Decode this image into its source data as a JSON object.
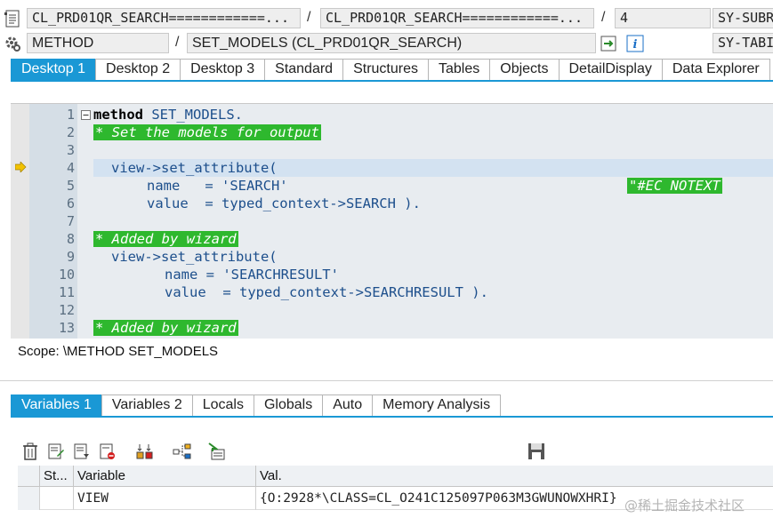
{
  "header": {
    "row1": {
      "field1": "CL_PRD01QR_SEARCH============...",
      "field2": "CL_PRD01QR_SEARCH============...",
      "field3": "4",
      "field4": "SY-SUBRC",
      "sep1": "/",
      "sep2": "/"
    },
    "row2": {
      "field1": "METHOD",
      "sep": "/",
      "field2": "SET_MODELS (CL_PRD01QR_SEARCH)",
      "field3": "SY-TABIX"
    }
  },
  "desktop_tabs": [
    "Desktop 1",
    "Desktop 2",
    "Desktop 3",
    "Standard",
    "Structures",
    "Tables",
    "Objects",
    "DetailDisplay",
    "Data Explorer"
  ],
  "active_desktop_tab": 0,
  "editor": {
    "current_line": 4,
    "lines": [
      {
        "n": "1",
        "text": "method SET_MODELS."
      },
      {
        "n": "2",
        "text": "* Set the models for output"
      },
      {
        "n": "3",
        "text": ""
      },
      {
        "n": "4",
        "text": "view->set_attribute("
      },
      {
        "n": "5",
        "text": "name   = 'SEARCH'",
        "pragma": "\"#EC NOTEXT"
      },
      {
        "n": "6",
        "text": "value  = typed_context->SEARCH )."
      },
      {
        "n": "7",
        "text": ""
      },
      {
        "n": "8",
        "text": "* Added by wizard"
      },
      {
        "n": "9",
        "text": "view->set_attribute("
      },
      {
        "n": "10",
        "text": "name = 'SEARCHRESULT'"
      },
      {
        "n": "11",
        "text": "value  = typed_context->SEARCHRESULT )."
      },
      {
        "n": "12",
        "text": ""
      },
      {
        "n": "13",
        "text": "* Added by wizard"
      }
    ]
  },
  "scope": "Scope: \\METHOD SET_MODELS",
  "variable_tabs": [
    "Variables 1",
    "Variables 2",
    "Locals",
    "Globals",
    "Auto",
    "Memory Analysis"
  ],
  "active_variable_tab": 0,
  "grid": {
    "columns": [
      "St...",
      "Variable",
      "Val."
    ],
    "rows": [
      {
        "status": "",
        "variable": "VIEW",
        "value": "{O:2928*\\CLASS=CL_O241C125097P063M3GWUNOWXHRI}"
      }
    ]
  },
  "watermark": "@稀土掘金技术社区",
  "colors": {
    "accent": "#1a98d5",
    "comment_bg": "#2eb82e",
    "editor_bg": "#e8ecf0"
  }
}
